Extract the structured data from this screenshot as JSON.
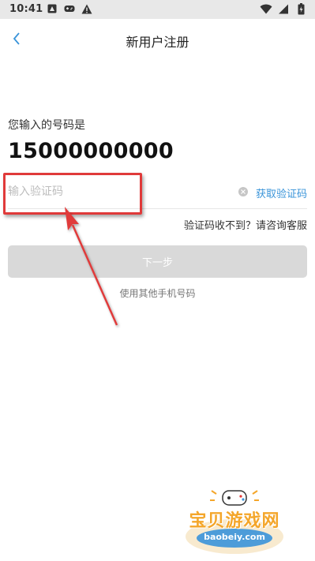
{
  "status_bar": {
    "time": "10:41"
  },
  "header": {
    "title": "新用户注册"
  },
  "form": {
    "phone_label": "您输入的号码是",
    "phone_number": "15000000000",
    "code_placeholder": "输入验证码",
    "code_value": "",
    "get_code": "获取验证码",
    "help": "验证码收不到？请咨询客服",
    "next_button": "下一步",
    "other_phone": "使用其他手机号码"
  },
  "watermark": {
    "brand": "宝贝游戏网",
    "url": "baobeiy.com"
  },
  "colors": {
    "link": "#3a94d9",
    "annotation": "#e03a3a",
    "button_disabled": "#d9d9d9"
  }
}
